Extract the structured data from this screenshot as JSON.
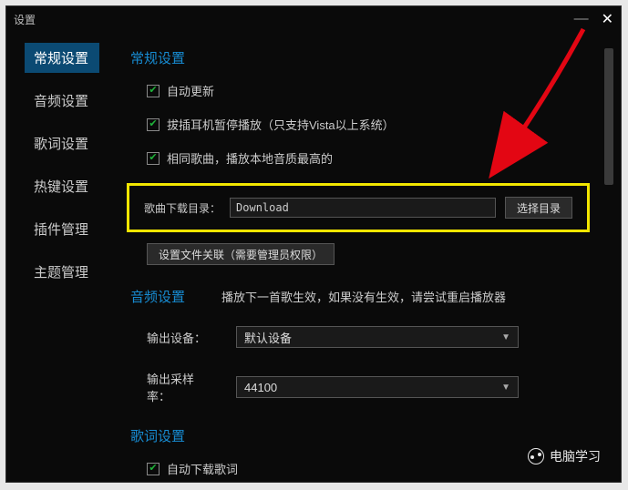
{
  "titlebar": {
    "title": "设置"
  },
  "sidebar": {
    "items": [
      {
        "label": "常规设置",
        "active": true
      },
      {
        "label": "音频设置",
        "active": false
      },
      {
        "label": "歌词设置",
        "active": false
      },
      {
        "label": "热键设置",
        "active": false
      },
      {
        "label": "插件管理",
        "active": false
      },
      {
        "label": "主题管理",
        "active": false
      }
    ]
  },
  "general": {
    "title": "常规设置",
    "auto_update": {
      "label": "自动更新",
      "checked": true
    },
    "headphone_pause": {
      "label": "拔插耳机暂停播放（只支持Vista以上系统）",
      "checked": true
    },
    "same_song": {
      "label": "相同歌曲，播放本地音质最高的",
      "checked": true
    },
    "download_dir_label": "歌曲下载目录：",
    "download_dir_value": "Download",
    "choose_dir_btn": "选择目录",
    "assoc_btn": "设置文件关联（需要管理员权限）"
  },
  "audio": {
    "title": "音频设置",
    "note": "播放下一首歌生效，如果没有生效，请尝试重启播放器",
    "output_device_label": "输出设备：",
    "output_device_value": "默认设备",
    "sample_rate_label": "输出采样率：",
    "sample_rate_value": "44100"
  },
  "lyric": {
    "title": "歌词设置",
    "auto_download": {
      "label": "自动下载歌词",
      "checked": true
    }
  },
  "watermark": {
    "text": "电脑学习"
  }
}
